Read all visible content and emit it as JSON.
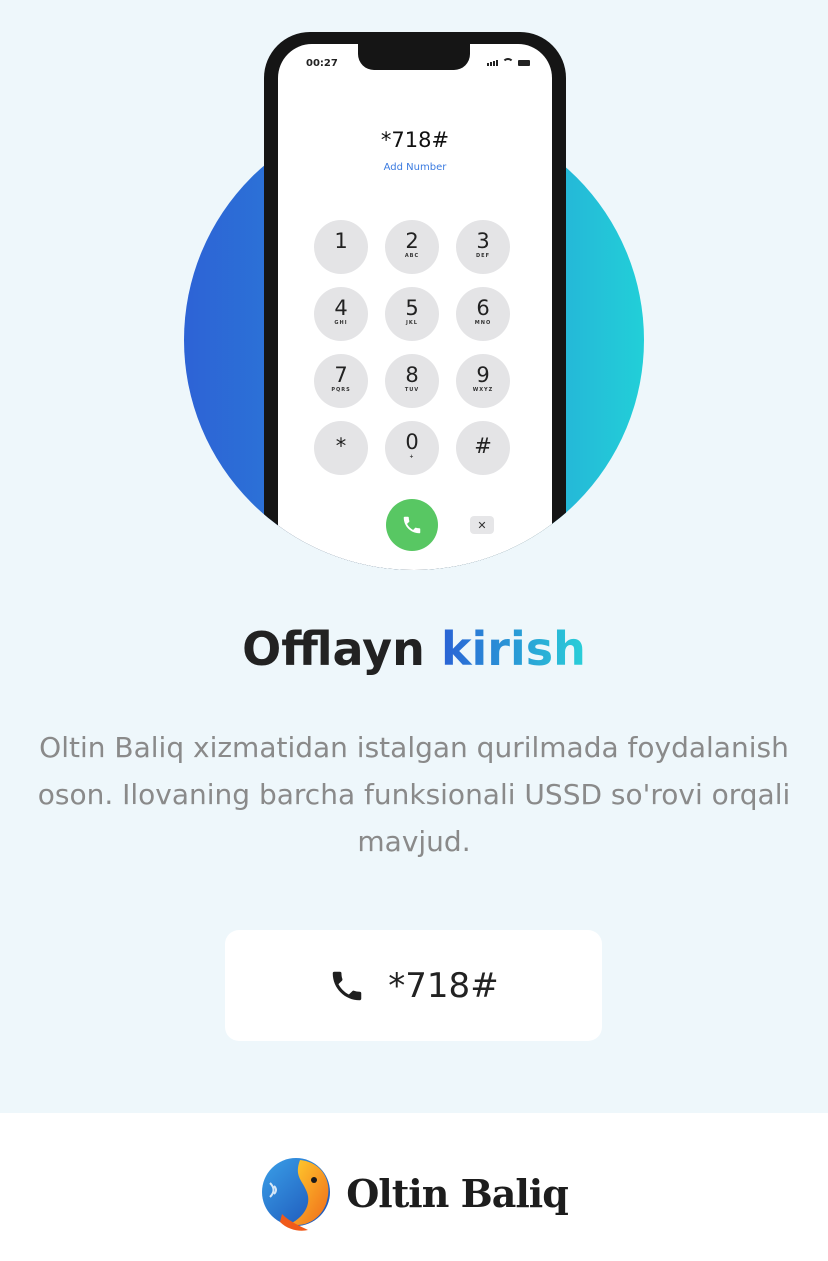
{
  "phone": {
    "status_time": "00:27",
    "dialed_number": "*718#",
    "add_number_label": "Add Number",
    "keys": [
      {
        "num": "1",
        "letters": ""
      },
      {
        "num": "2",
        "letters": "ABC"
      },
      {
        "num": "3",
        "letters": "DEF"
      },
      {
        "num": "4",
        "letters": "GHI"
      },
      {
        "num": "5",
        "letters": "JKL"
      },
      {
        "num": "6",
        "letters": "MNO"
      },
      {
        "num": "7",
        "letters": "PQRS"
      },
      {
        "num": "8",
        "letters": "TUV"
      },
      {
        "num": "9",
        "letters": "WXYZ"
      },
      {
        "num": "*",
        "letters": ""
      },
      {
        "num": "0",
        "letters": "+"
      },
      {
        "num": "#",
        "letters": ""
      }
    ],
    "call_icon": "phone-icon",
    "delete_icon": "backspace-icon"
  },
  "heading": {
    "part1": "Offlayn ",
    "part2": "kirish"
  },
  "description": "Oltin Baliq xizmatidan istalgan qurilmada foydalanish oson. Ilovaning barcha funksionali USSD so'rovi orqali mavjud.",
  "ussd_button": {
    "icon": "phone-icon",
    "code": "*718#"
  },
  "footer": {
    "logo_text": "Oltin Baliq"
  },
  "colors": {
    "background": "#eef7fb",
    "gradient_start": "#2d63d6",
    "gradient_end": "#22cfd8",
    "call_green": "#58c763",
    "text_dark": "#222222",
    "text_gray": "#8a8a8a"
  }
}
